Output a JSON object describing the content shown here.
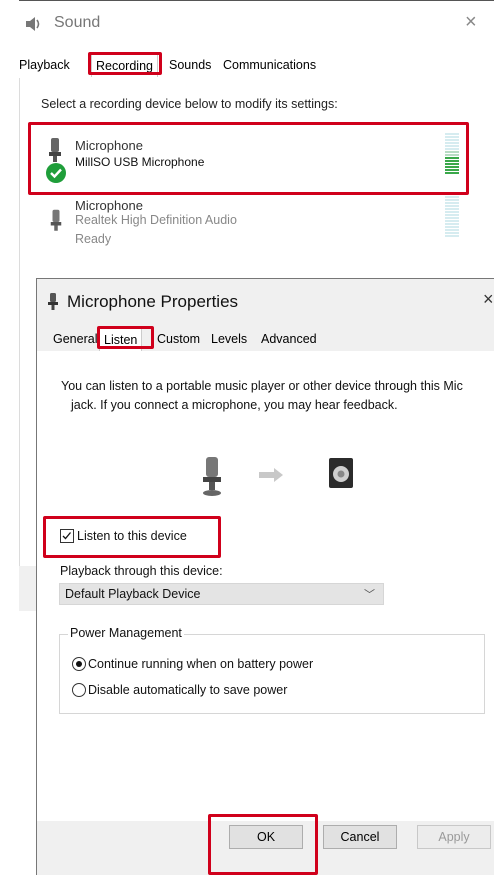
{
  "sound_dialog": {
    "title": "Sound",
    "close_glyph": "×",
    "tabs": [
      {
        "label": "Playback"
      },
      {
        "label": "Recording",
        "active": true
      },
      {
        "label": "Sounds"
      },
      {
        "label": "Communications"
      }
    ],
    "instruction": "Select a recording device below to modify its settings:",
    "devices": [
      {
        "name": "Microphone",
        "description": "MillSO USB Microphone",
        "status": "",
        "default": true,
        "icon": "microphone-icon"
      },
      {
        "name": "Microphone",
        "description": "Realtek High Definition Audio",
        "status": "Ready",
        "default": false,
        "icon": "microphone-icon"
      }
    ]
  },
  "properties_dialog": {
    "title": "Microphone Properties",
    "close_glyph": "×",
    "tabs": [
      {
        "label": "General"
      },
      {
        "label": "Listen",
        "active": true
      },
      {
        "label": "Custom"
      },
      {
        "label": "Levels"
      },
      {
        "label": "Advanced"
      }
    ],
    "description_line1": "You can listen to a portable music player or other device through this Mic",
    "description_line2": "jack.  If you connect a microphone, you may hear feedback.",
    "listen_checkbox": {
      "label": "Listen to this device",
      "checked": true
    },
    "playback_through_label": "Playback through this device:",
    "playback_device": {
      "selected": "Default Playback Device"
    },
    "power_management": {
      "legend": "Power Management",
      "options": [
        {
          "label": "Continue running when on battery power",
          "selected": true
        },
        {
          "label": "Disable automatically to save power",
          "selected": false
        }
      ]
    },
    "buttons": {
      "ok": "OK",
      "cancel": "Cancel",
      "apply": "Apply"
    }
  },
  "colors": {
    "highlight_red": "#d0001b",
    "meter_green": "#3aa84a",
    "check_green": "#1f9e3a"
  }
}
